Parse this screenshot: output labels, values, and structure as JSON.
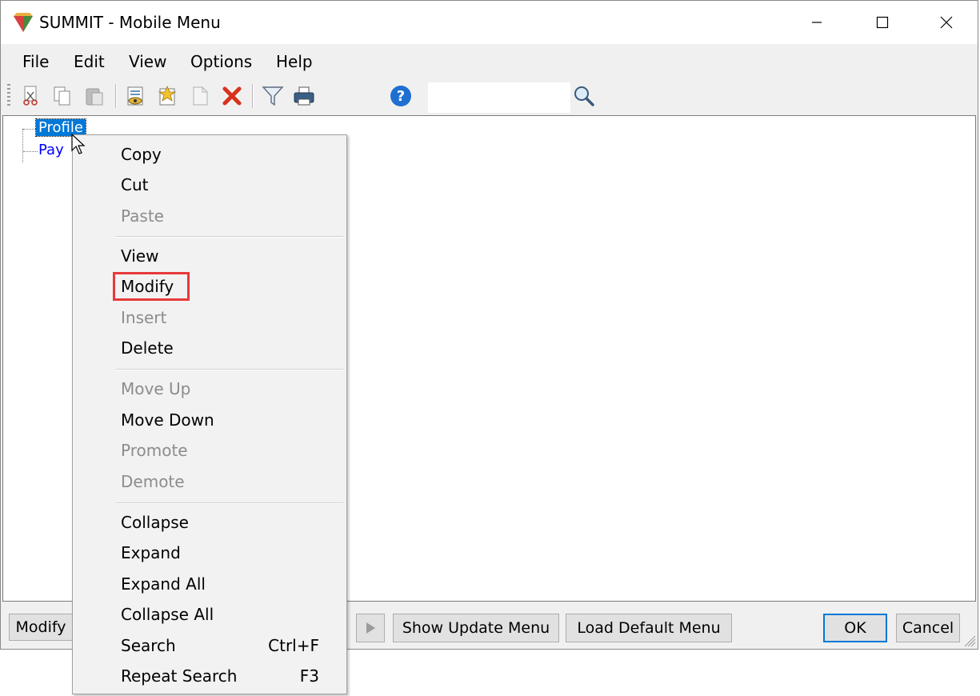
{
  "window": {
    "title": "SUMMIT - Mobile Menu",
    "app_icon": "summit-app-icon",
    "controls": {
      "minimize": "minimize-icon",
      "maximize": "maximize-icon",
      "close": "close-icon"
    }
  },
  "menubar": {
    "items": [
      {
        "label": "File"
      },
      {
        "label": "Edit"
      },
      {
        "label": "View"
      },
      {
        "label": "Options"
      },
      {
        "label": "Help"
      }
    ]
  },
  "toolbar": {
    "icons": [
      "cut-icon",
      "copy-icon",
      "paste-icon",
      "view-icon",
      "modify-icon",
      "insert-icon",
      "delete-icon",
      "filter-icon",
      "print-icon",
      "help-icon",
      "search-icon"
    ],
    "search": {
      "value": ""
    }
  },
  "tree": {
    "nodes": [
      {
        "label": "Profile",
        "selected": true
      },
      {
        "label": "Pay",
        "selected": false
      }
    ]
  },
  "context_menu": {
    "groups": [
      [
        {
          "label": "Copy",
          "enabled": true
        },
        {
          "label": "Cut",
          "enabled": true
        },
        {
          "label": "Paste",
          "enabled": false
        }
      ],
      [
        {
          "label": "View",
          "enabled": true
        },
        {
          "label": "Modify",
          "enabled": true,
          "highlighted": true
        },
        {
          "label": "Insert",
          "enabled": false
        },
        {
          "label": "Delete",
          "enabled": true
        }
      ],
      [
        {
          "label": "Move Up",
          "enabled": false
        },
        {
          "label": "Move Down",
          "enabled": true
        },
        {
          "label": "Promote",
          "enabled": false
        },
        {
          "label": "Demote",
          "enabled": false
        }
      ],
      [
        {
          "label": "Collapse",
          "enabled": true
        },
        {
          "label": "Expand",
          "enabled": true
        },
        {
          "label": "Expand All",
          "enabled": true
        },
        {
          "label": "Collapse All",
          "enabled": true
        },
        {
          "label": "Search",
          "enabled": true,
          "shortcut": "Ctrl+F"
        },
        {
          "label": "Repeat Search",
          "enabled": true,
          "shortcut": "F3"
        }
      ]
    ]
  },
  "bottom": {
    "modify_label": "Modify",
    "show_update_label": "Show Update Menu",
    "load_default_label": "Load Default Menu",
    "ok_label": "OK",
    "cancel_label": "Cancel"
  },
  "colors": {
    "selection": "#0078d7",
    "link": "#0000ff",
    "highlight_box": "#e8393a",
    "delete_icon": "#d9301e",
    "help_icon": "#1f6fd1"
  }
}
